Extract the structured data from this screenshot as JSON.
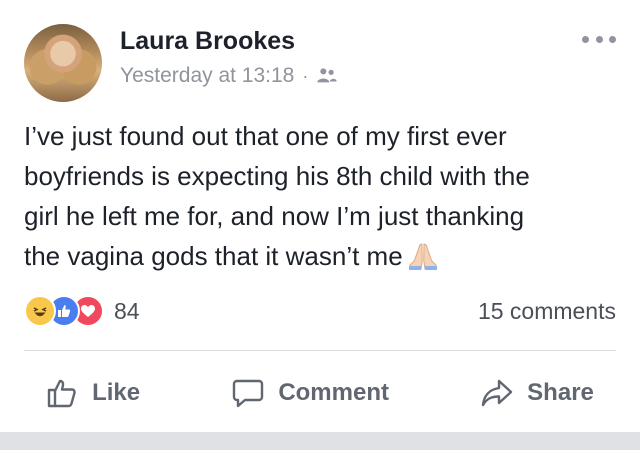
{
  "post": {
    "author": "Laura Brookes",
    "timestamp": "Yesterday at 13:18",
    "separator": "·",
    "audience_icon": "friends-icon",
    "text_lines": [
      "I’ve just found out that one of my first ever",
      "boyfriends is expecting his 8th child with the",
      "girl he left me for, and now I’m just thanking",
      "the vagina gods that it wasn’t me"
    ],
    "emoji": "folded-hands"
  },
  "reactions": {
    "types": [
      "haha",
      "like",
      "love"
    ],
    "count": "84"
  },
  "comments": {
    "count_label": "15 comments"
  },
  "actions": {
    "like_label": "Like",
    "comment_label": "Comment",
    "share_label": "Share"
  },
  "colors": {
    "text": "#1d2129",
    "meta": "#90949c",
    "action": "#606770",
    "like_blue": "#4a7dee",
    "love_red": "#f0485d",
    "haha_yellow": "#f7c84b"
  }
}
